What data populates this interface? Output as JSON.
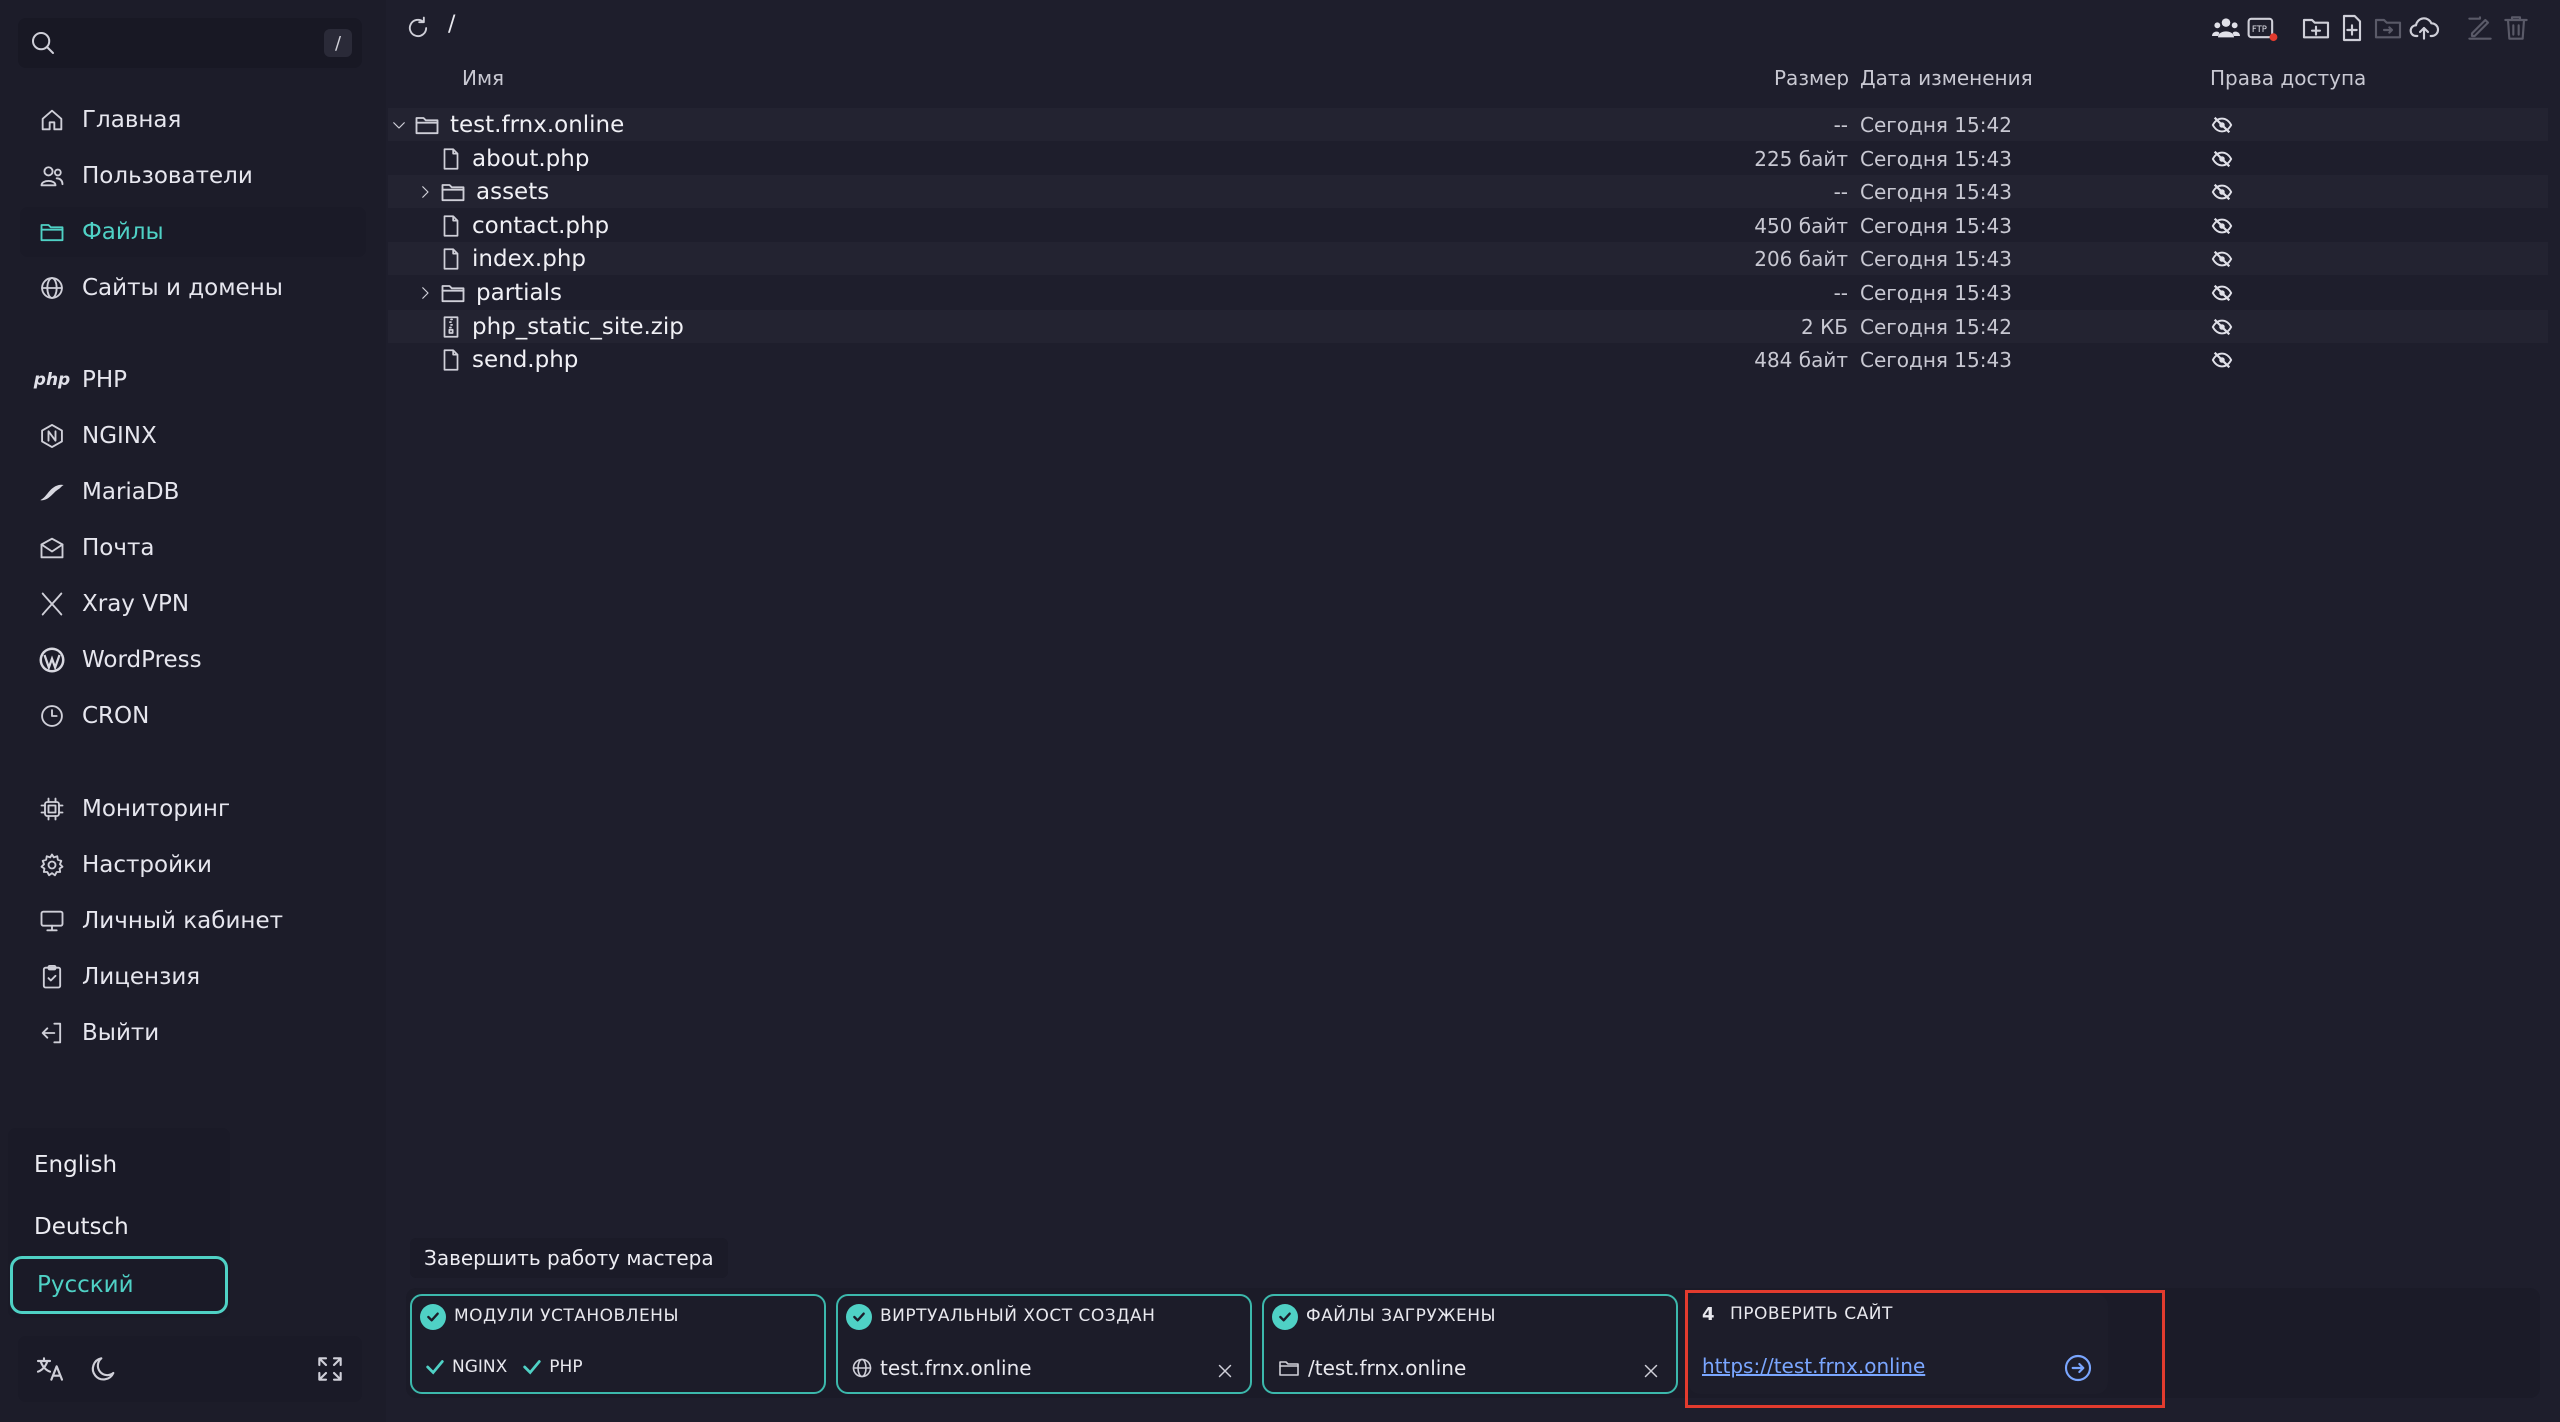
{
  "search": {
    "shortcut": "/"
  },
  "nav": {
    "main": [
      {
        "label": "Главная",
        "icon": "home-icon"
      },
      {
        "label": "Пользователи",
        "icon": "users-icon"
      },
      {
        "label": "Файлы",
        "icon": "folder-icon",
        "active": true
      },
      {
        "label": "Сайты и домены",
        "icon": "globe-icon"
      }
    ],
    "services": [
      {
        "label": "PHP",
        "icon": "php-icon"
      },
      {
        "label": "NGINX",
        "icon": "nginx-icon"
      },
      {
        "label": "MariaDB",
        "icon": "mariadb-icon"
      },
      {
        "label": "Почта",
        "icon": "mail-icon"
      },
      {
        "label": "Xray VPN",
        "icon": "xray-icon"
      },
      {
        "label": "WordPress",
        "icon": "wordpress-icon"
      },
      {
        "label": "CRON",
        "icon": "clock-icon"
      }
    ],
    "system": [
      {
        "label": "Мониторинг",
        "icon": "cpu-icon"
      },
      {
        "label": "Настройки",
        "icon": "settings-icon"
      },
      {
        "label": "Личный кабинет",
        "icon": "monitor-icon"
      },
      {
        "label": "Лицензия",
        "icon": "license-icon"
      },
      {
        "label": "Выйти",
        "icon": "logout-icon"
      }
    ]
  },
  "languages": {
    "items": [
      "English",
      "Deutsch",
      "Русский"
    ],
    "selected": "Русский"
  },
  "topbar": {
    "path": "/"
  },
  "table": {
    "headers": {
      "name": "Имя",
      "size": "Размер",
      "date": "Дата изменения",
      "perm": "Права доступа"
    },
    "rows": [
      {
        "name": "test.frnx.online",
        "type": "folder",
        "expanded": true,
        "depth": 0,
        "size": "--",
        "date": "Сегодня 15:42"
      },
      {
        "name": "about.php",
        "type": "file",
        "depth": 1,
        "size": "225 байт",
        "date": "Сегодня 15:43"
      },
      {
        "name": "assets",
        "type": "folder",
        "expanded": false,
        "depth": 1,
        "size": "--",
        "date": "Сегодня 15:43"
      },
      {
        "name": "contact.php",
        "type": "file",
        "depth": 1,
        "size": "450 байт",
        "date": "Сегодня 15:43"
      },
      {
        "name": "index.php",
        "type": "file",
        "depth": 1,
        "size": "206 байт",
        "date": "Сегодня 15:43"
      },
      {
        "name": "partials",
        "type": "folder",
        "expanded": false,
        "depth": 1,
        "size": "--",
        "date": "Сегодня 15:43"
      },
      {
        "name": "php_static_site.zip",
        "type": "zip",
        "depth": 1,
        "size": "2 КБ",
        "date": "Сегодня 15:42"
      },
      {
        "name": "send.php",
        "type": "file",
        "depth": 1,
        "size": "484 байт",
        "date": "Сегодня 15:43"
      }
    ]
  },
  "wizard": {
    "finish_label": "Завершить работу мастера",
    "step1": {
      "title": "МОДУЛИ УСТАНОВЛЕНЫ",
      "modules": [
        "NGINX",
        "PHP"
      ]
    },
    "step2": {
      "title": "ВИРТУАЛЬНЫЙ ХОСТ СОЗДАН",
      "value": "test.frnx.online"
    },
    "step3": {
      "title": "ФАЙЛЫ ЗАГРУЖЕНЫ",
      "value": "/test.frnx.online"
    },
    "step4": {
      "number": "4",
      "title": "ПРОВЕРИТЬ САЙТ",
      "link": "https://test.frnx.online"
    }
  },
  "colors": {
    "accent": "#4fd1c5",
    "highlight": "#e23b2e",
    "link": "#7aa6ff"
  }
}
